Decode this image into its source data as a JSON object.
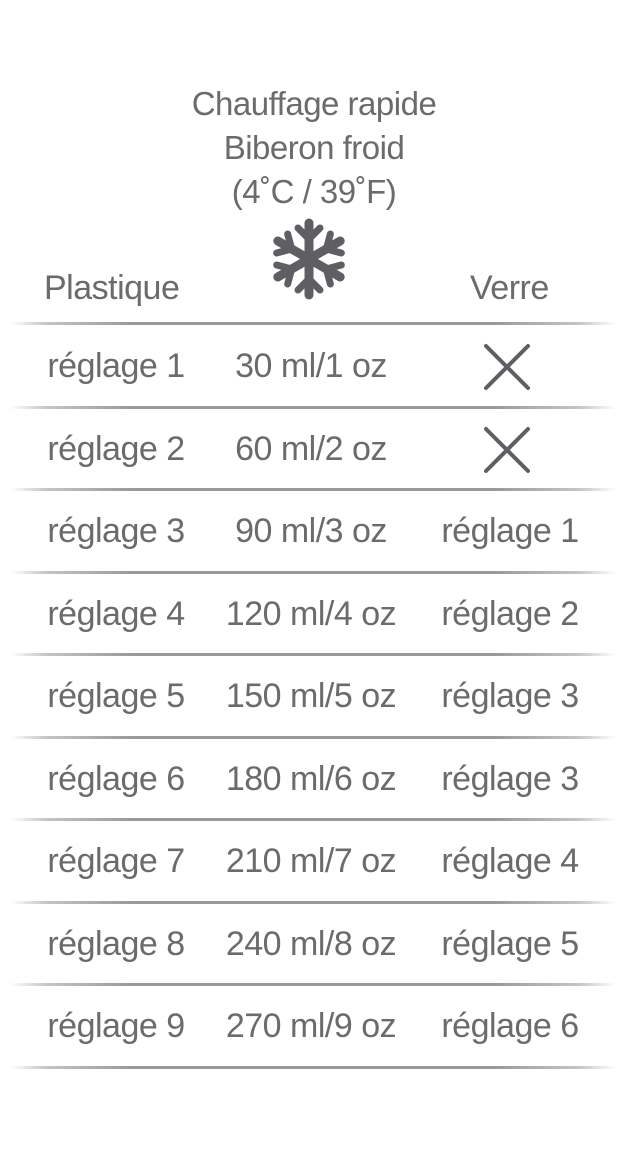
{
  "header": {
    "line1": "Chauffage rapide",
    "line2": "Biberon froid",
    "line3": "(4˚C / 39˚F)",
    "icon": "snowflake-icon"
  },
  "columns": {
    "left": "Plastique",
    "right": "Verre"
  },
  "colors": {
    "text": "#6b6b6e",
    "icon": "#5f5f63",
    "divider": "#9a9a9a"
  },
  "rows": [
    {
      "plastic": "réglage 1",
      "volume": "30 ml/1 oz",
      "glass": null,
      "glass_icon": "x-icon"
    },
    {
      "plastic": "réglage 2",
      "volume": "60 ml/2 oz",
      "glass": null,
      "glass_icon": "x-icon"
    },
    {
      "plastic": "réglage 3",
      "volume": "90 ml/3 oz",
      "glass": "réglage 1"
    },
    {
      "plastic": "réglage 4",
      "volume": "120 ml/4 oz",
      "glass": "réglage 2"
    },
    {
      "plastic": "réglage 5",
      "volume": "150 ml/5 oz",
      "glass": "réglage 3"
    },
    {
      "plastic": "réglage 6",
      "volume": "180 ml/6 oz",
      "glass": "réglage 3"
    },
    {
      "plastic": "réglage 7",
      "volume": "210 ml/7 oz",
      "glass": "réglage 4"
    },
    {
      "plastic": "réglage 8",
      "volume": "240 ml/8 oz",
      "glass": "réglage 5"
    },
    {
      "plastic": "réglage 9",
      "volume": "270 ml/9 oz",
      "glass": "réglage 6"
    }
  ]
}
